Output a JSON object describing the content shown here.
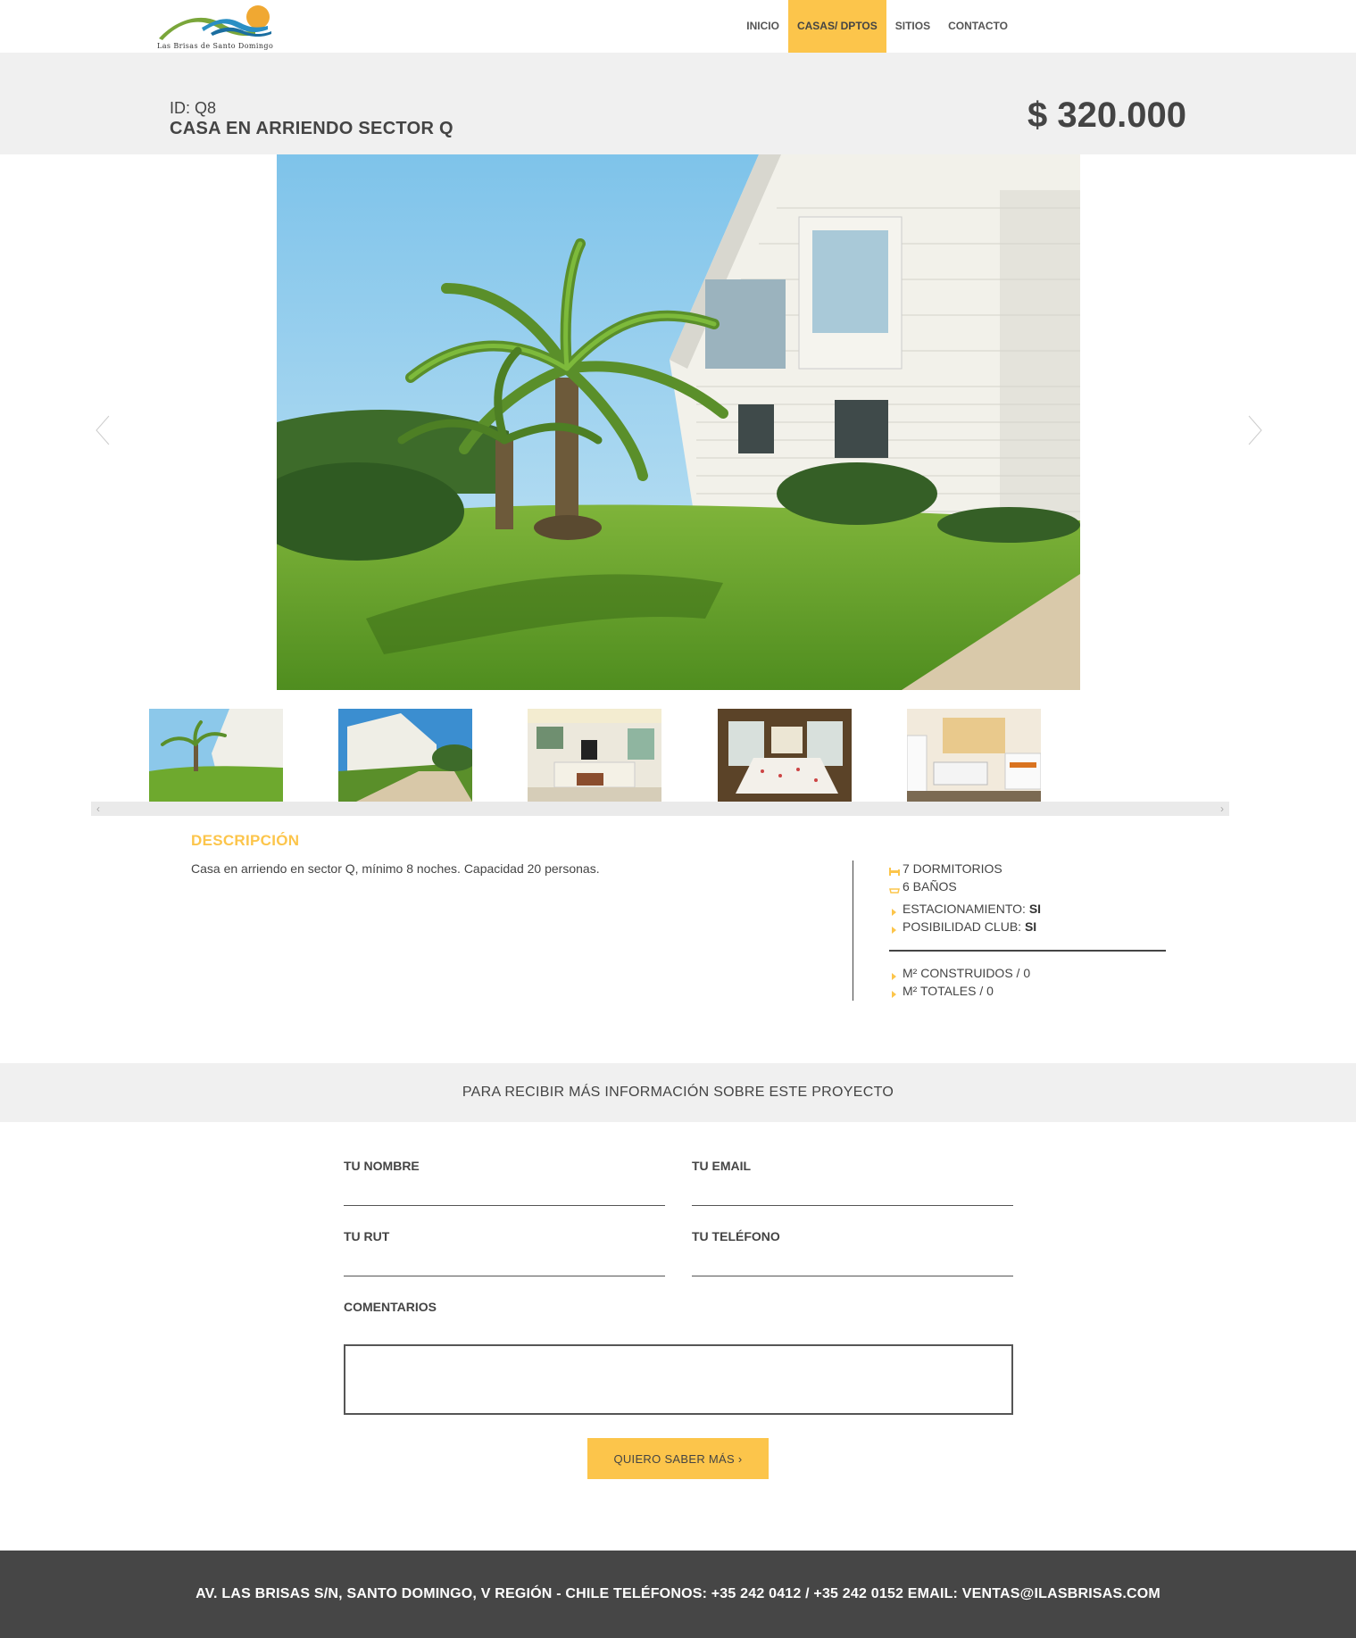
{
  "logo": {
    "text": "Las Brisas de Santo Domingo",
    "icon": "sun-and-waves-logo"
  },
  "nav": {
    "items": [
      {
        "label": "INICIO",
        "active": false
      },
      {
        "label": "CASAS/ DPTOS",
        "active": true
      },
      {
        "label": "SITIOS",
        "active": false
      },
      {
        "label": "CONTACTO",
        "active": false
      }
    ]
  },
  "property": {
    "id": "ID: Q8",
    "title": "CASA EN ARRIENDO SECTOR Q",
    "price": "$ 320.000"
  },
  "gallery": {
    "main_image": "house-with-palm-tree-photo",
    "thumbnails": [
      {
        "subject": "house-with-palm-tree"
      },
      {
        "subject": "house-with-driveway"
      },
      {
        "subject": "living-room"
      },
      {
        "subject": "dining-room"
      },
      {
        "subject": "kitchen"
      }
    ],
    "prev_icon": "chevron-left-icon",
    "next_icon": "chevron-right-icon"
  },
  "description": {
    "heading": "DESCRIPCIÓN",
    "text": "Casa en arriendo en sector Q, mínimo 8 noches. Capacidad 20 personas."
  },
  "features": {
    "dormitorios": "7 DORMITORIOS",
    "banos": "6 BAÑOS",
    "estacionamiento_label": "ESTACIONAMIENTO:",
    "estacionamiento_value": "SI",
    "club_label": "POSIBILIDAD CLUB:",
    "club_value": "SI",
    "construidos": "M² CONSTRUIDOS / 0",
    "totales": "M² TOTALES / 0"
  },
  "info_band": {
    "text": "PARA RECIBIR MÁS INFORMACIÓN SOBRE ESTE PROYECTO"
  },
  "form": {
    "nombre_label": "TU NOMBRE",
    "email_label": "TU EMAIL",
    "rut_label": "TU RUT",
    "telefono_label": "TU TELÉFONO",
    "comentarios_label": "COMENTARIOS",
    "submit_label": "QUIERO SABER MÁS  ›"
  },
  "footer": {
    "text": "AV. LAS BRISAS S/N, SANTO DOMINGO, V REGIÓN - CHILE TELÉFONOS: +35 242 0412 / +35 242 0152 EMAIL: VENTAS@ILASBRISAS.COM"
  },
  "colors": {
    "accent": "#fcc54b",
    "band": "#f0f0f0",
    "footer": "#464646",
    "text": "#444444"
  }
}
